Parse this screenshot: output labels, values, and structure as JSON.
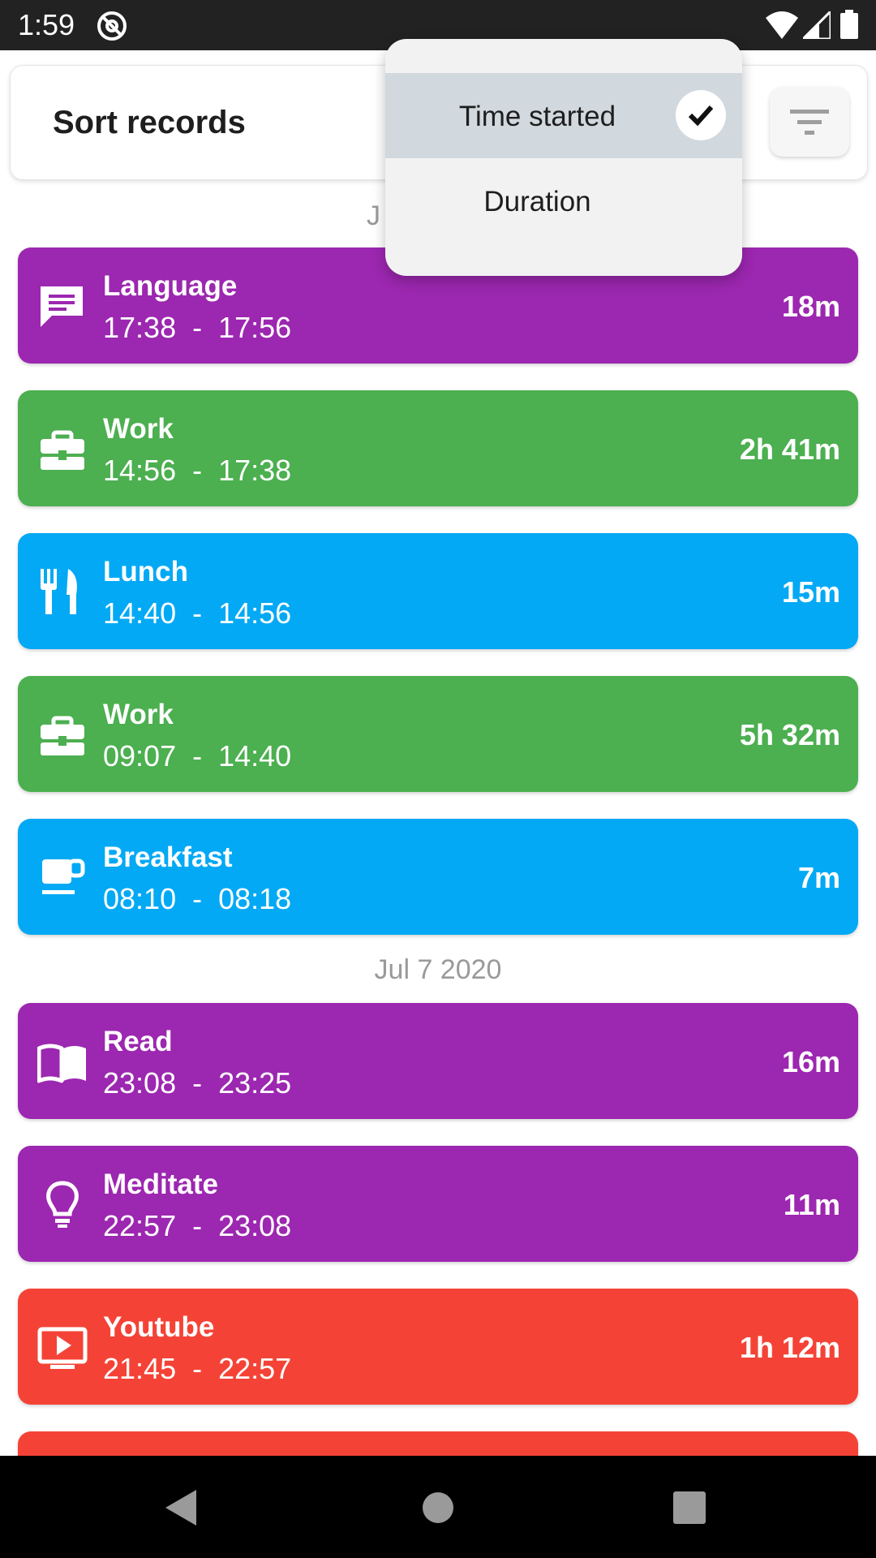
{
  "status_bar": {
    "time": "1:59"
  },
  "header": {
    "title": "Sort records"
  },
  "sort_menu": {
    "options": [
      {
        "label": "Time started",
        "selected": true
      },
      {
        "label": "Duration",
        "selected": false
      }
    ]
  },
  "date_headers": [
    "J",
    "Jul 7 2020"
  ],
  "records": [
    {
      "title": "Language",
      "time": "17:38  -  17:56",
      "duration": "18m",
      "icon": "chat-icon",
      "color": "#9c27b0"
    },
    {
      "title": "Work",
      "time": "14:56  -  17:38",
      "duration": "2h 41m",
      "icon": "briefcase-icon",
      "color": "#4caf50"
    },
    {
      "title": "Lunch",
      "time": "14:40  -  14:56",
      "duration": "15m",
      "icon": "utensils-icon",
      "color": "#03a9f4"
    },
    {
      "title": "Work",
      "time": "09:07  -  14:40",
      "duration": "5h 32m",
      "icon": "briefcase-icon",
      "color": "#4caf50"
    },
    {
      "title": "Breakfast",
      "time": "08:10  -  08:18",
      "duration": "7m",
      "icon": "coffee-cup-icon",
      "color": "#03a9f4"
    },
    {
      "title": "Read",
      "time": "23:08  -  23:25",
      "duration": "16m",
      "icon": "book-icon",
      "color": "#9c27b0"
    },
    {
      "title": "Meditate",
      "time": "22:57  -  23:08",
      "duration": "11m",
      "icon": "lightbulb-icon",
      "color": "#9c27b0"
    },
    {
      "title": "Youtube",
      "time": "21:45  -  22:57",
      "duration": "1h 12m",
      "icon": "video-player-icon",
      "color": "#f44336"
    },
    {
      "color": "#f44336"
    }
  ]
}
